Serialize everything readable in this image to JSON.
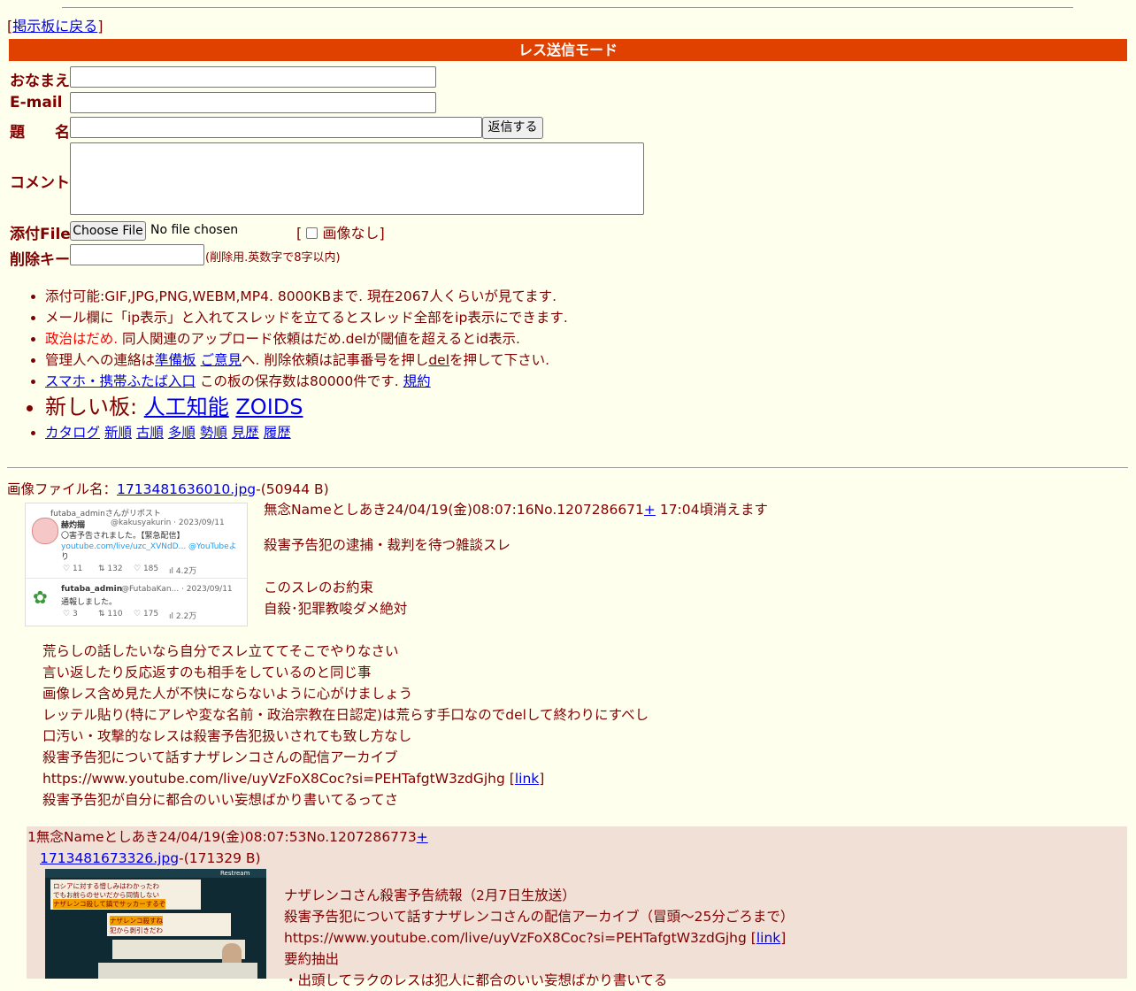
{
  "nav": {
    "back_prefix": "[",
    "back_link": "掲示板に戻る",
    "back_suffix": "]"
  },
  "mode_title": "レス送信モード",
  "form": {
    "name_label": "おなまえ",
    "email_label": "E-mail",
    "subject_label": "題　　名",
    "submit_label": "返信する",
    "comment_label": "コメント",
    "file_label": "添付File",
    "choose_file": "Choose File",
    "no_file": "No file chosen",
    "no_image_open": "[",
    "no_image_label": "画像なし]",
    "delkey_label": "削除キー",
    "delkey_hint": "(削除用.英数字で8字以内)"
  },
  "notes": {
    "n1": "添付可能:GIF,JPG,PNG,WEBM,MP4. 8000KBまで. 現在2067人くらいが見てます.",
    "n2": "メール欄に「ip表示」と入れてスレッドを立てるとスレッド全部をip表示にできます.",
    "n3_red": "政治はだめ.",
    "n3_rest": " 同人関連のアップロード依頼はだめ.delが閾値を超えるとid表示.",
    "n4_a": "管理人への連絡は",
    "n4_link1": "準備板",
    "n4_link2": "ご意見",
    "n4_b": "へ. 削除依頼は記事番号を押し",
    "n4_del": "del",
    "n4_c": "を押して下さい.",
    "n5_link": "スマホ・携帯ふたば入口",
    "n5_text": " この板の保存数は80000件です. ",
    "n5_link2": "規約",
    "n6_text": "新しい板: ",
    "n6_link1": "人工知能",
    "n6_link2": "ZOIDS",
    "sort": [
      "カタログ",
      "新順",
      "古順",
      "多順",
      "勢順",
      "見歴",
      "履歴"
    ]
  },
  "thread": {
    "file_prefix": "画像ファイル名：",
    "file_name": "1713481636010.jpg",
    "file_size": "-(50944 B)",
    "header": "無念Nameとしあき24/04/19(金)08:07:16No.1207286671",
    "plus": "+",
    "expire": " 17:04頃消えます",
    "lines_a": [
      "殺害予告犯の逮捕・裁判を待つ雑談スレ",
      "",
      "このスレのお約束",
      "自殺･犯罪教唆ダメ絶対"
    ],
    "lines_b": [
      "荒らしの話したいなら自分でスレ立ててそこでやりなさい",
      "言い返したり反応返すのも相手をしているのと同じ事",
      "画像レス含め見た人が不快にならないように心がけましょう",
      "レッテル貼り(特にアレや変な名前・政治宗教在日認定)は荒らす手口なのでdelして終わりにすべし",
      "口汚い・攻撃的なレスは殺害予告犯扱いされても致し方なし",
      "殺害予告犯について話すナザレンコさんの配信アーカイブ"
    ],
    "url": "https://www.youtube.com/live/uyVzFoX8Coc?si=PEHTafgtW3zdGjhg [",
    "url_link": "link",
    "url_close": "]",
    "last_line": "殺害予告犯が自分に都合のいい妄想ばかり書いてるってさ"
  },
  "thumb1": {
    "repost": "futaba_adminさんがリポスト",
    "user1": "赫灼搦",
    "handle1": "@kakusyakurin · 2023/09/11",
    "text1a": "〇害予告されました。【緊急配信】",
    "text1b": "youtube.com/live/uzc_XVNdD... @YouTubeよ",
    "text1c": "り",
    "stats1": [
      "11",
      "132",
      "185",
      "4.2万"
    ],
    "user2": "futaba_admin",
    "handle2": "@FutabaKan... · 2023/09/11",
    "text2": "通報しました。",
    "stats2": [
      "3",
      "110",
      "175",
      "2.2万"
    ]
  },
  "reply": {
    "header": "1無念Nameとしあき24/04/19(金)08:07:53No.1207286773",
    "plus": "+",
    "file_name": "1713481673326.jpg",
    "file_size": "-(171329 B)",
    "lines": [
      "ナザレンコさん殺害予告続報（2月7日生放送）",
      "殺害予告犯について話すナザレンコさんの配信アーカイブ（冒頭～25分ごろまで）"
    ],
    "url": "https://www.youtube.com/live/uyVzFoX8Coc?si=PEHTafgtW3zdGjhg [",
    "url_link": "link",
    "url_close": "]",
    "line_last": "要約抽出",
    "line_cut": "・出頭してラクのレスは犯人に都合のいい妄想ばかり書いてる"
  },
  "thumb2": {
    "t1": "ロシアに対する憎しみはわかったわ",
    "t2": "でもお前らのせいだから同情しない",
    "t3": "ナザレンコ殺して鎮でサッカーするぞ",
    "t4": "ナザレンコ殺すね",
    "t5": "犯から剥引きだわ",
    "badge": "Restream"
  },
  "colors": {
    "accent": "#e04000",
    "bg": "#ffffee",
    "reply_bg": "#f0e0d6",
    "text": "#800000",
    "link": "#0000ee"
  }
}
